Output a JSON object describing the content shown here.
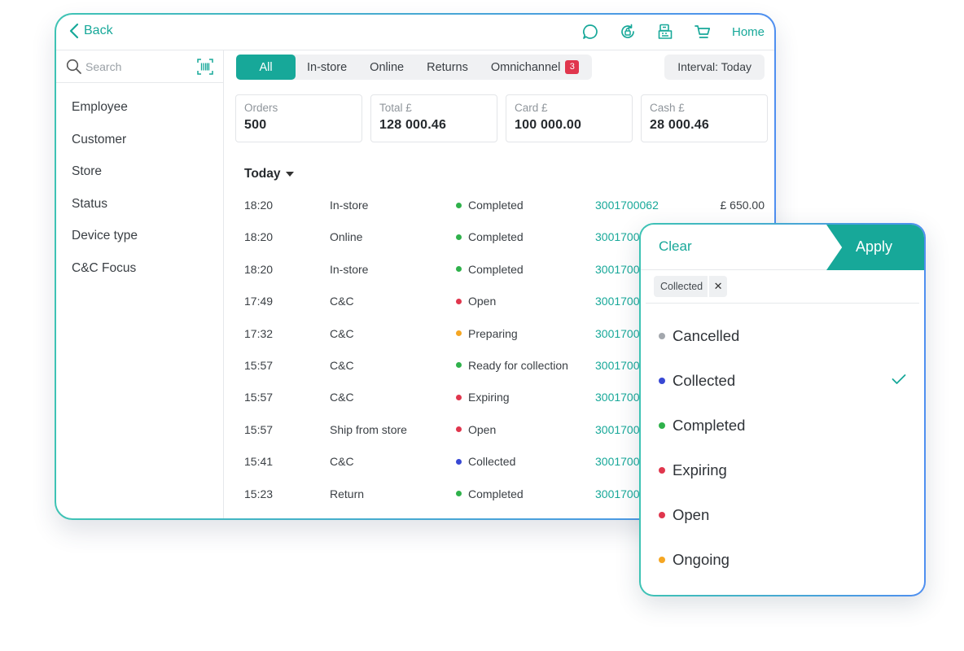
{
  "topbar": {
    "back_label": "Back",
    "home_label": "Home",
    "icons": [
      "chat-icon",
      "refresh-lock-icon",
      "register-icon",
      "cart-icon"
    ]
  },
  "search": {
    "placeholder": "Search"
  },
  "sidebar": {
    "items": [
      "Employee",
      "Customer",
      "Store",
      "Status",
      "Device type",
      "C&C Focus"
    ]
  },
  "tabs": {
    "all": "All",
    "instore": "In-store",
    "online": "Online",
    "returns": "Returns",
    "omnichannel": "Omnichannel",
    "omnichannel_badge": "3"
  },
  "interval": "Interval: Today",
  "stats": [
    {
      "label": "Orders",
      "value": "500"
    },
    {
      "label": "Total £",
      "value": "128 000.46"
    },
    {
      "label": "Card £",
      "value": "100 000.00"
    },
    {
      "label": "Cash £",
      "value": "28 000.46"
    }
  ],
  "group_label": "Today",
  "colors": {
    "accent": "#17a899",
    "completed": "#2fb14b",
    "open": "#e0364d",
    "preparing": "#f5a623",
    "collected": "#3848d4",
    "cancelled": "#a3a7ad"
  },
  "orders": [
    {
      "time": "18:20",
      "channel": "In-store",
      "status": "Completed",
      "status_color": "#2fb14b",
      "id": "3001700062",
      "amount": "£ 650.00"
    },
    {
      "time": "18:20",
      "channel": "Online",
      "status": "Completed",
      "status_color": "#2fb14b",
      "id": "30017000",
      "amount": ""
    },
    {
      "time": "18:20",
      "channel": "In-store",
      "status": "Completed",
      "status_color": "#2fb14b",
      "id": "3001700",
      "amount": ""
    },
    {
      "time": "17:49",
      "channel": "C&C",
      "status": "Open",
      "status_color": "#e0364d",
      "id": "3001700",
      "amount": ""
    },
    {
      "time": "17:32",
      "channel": "C&C",
      "status": "Preparing",
      "status_color": "#f5a623",
      "id": "3001700",
      "amount": ""
    },
    {
      "time": "15:57",
      "channel": "C&C",
      "status": "Ready for collection",
      "status_color": "#2fb14b",
      "id": "3001700",
      "amount": ""
    },
    {
      "time": "15:57",
      "channel": "C&C",
      "status": "Expiring",
      "status_color": "#e0364d",
      "id": "3001700",
      "amount": ""
    },
    {
      "time": "15:57",
      "channel": "Ship from store",
      "status": "Open",
      "status_color": "#e0364d",
      "id": "3001700",
      "amount": ""
    },
    {
      "time": "15:41",
      "channel": "C&C",
      "status": "Collected",
      "status_color": "#3848d4",
      "id": "3001700",
      "amount": ""
    },
    {
      "time": "15:23",
      "channel": "Return",
      "status": "Completed",
      "status_color": "#2fb14b",
      "id": "3001700",
      "amount": ""
    }
  ],
  "filter": {
    "clear_label": "Clear",
    "apply_label": "Apply",
    "chip_label": "Collected",
    "chip_remove": "✕",
    "options": [
      {
        "label": "Cancelled",
        "color": "#a3a7ad",
        "selected": false
      },
      {
        "label": "Collected",
        "color": "#3848d4",
        "selected": true
      },
      {
        "label": "Completed",
        "color": "#2fb14b",
        "selected": false
      },
      {
        "label": "Expiring",
        "color": "#e0364d",
        "selected": false
      },
      {
        "label": "Open",
        "color": "#e0364d",
        "selected": false
      },
      {
        "label": "Ongoing",
        "color": "#f5a623",
        "selected": false
      }
    ]
  }
}
